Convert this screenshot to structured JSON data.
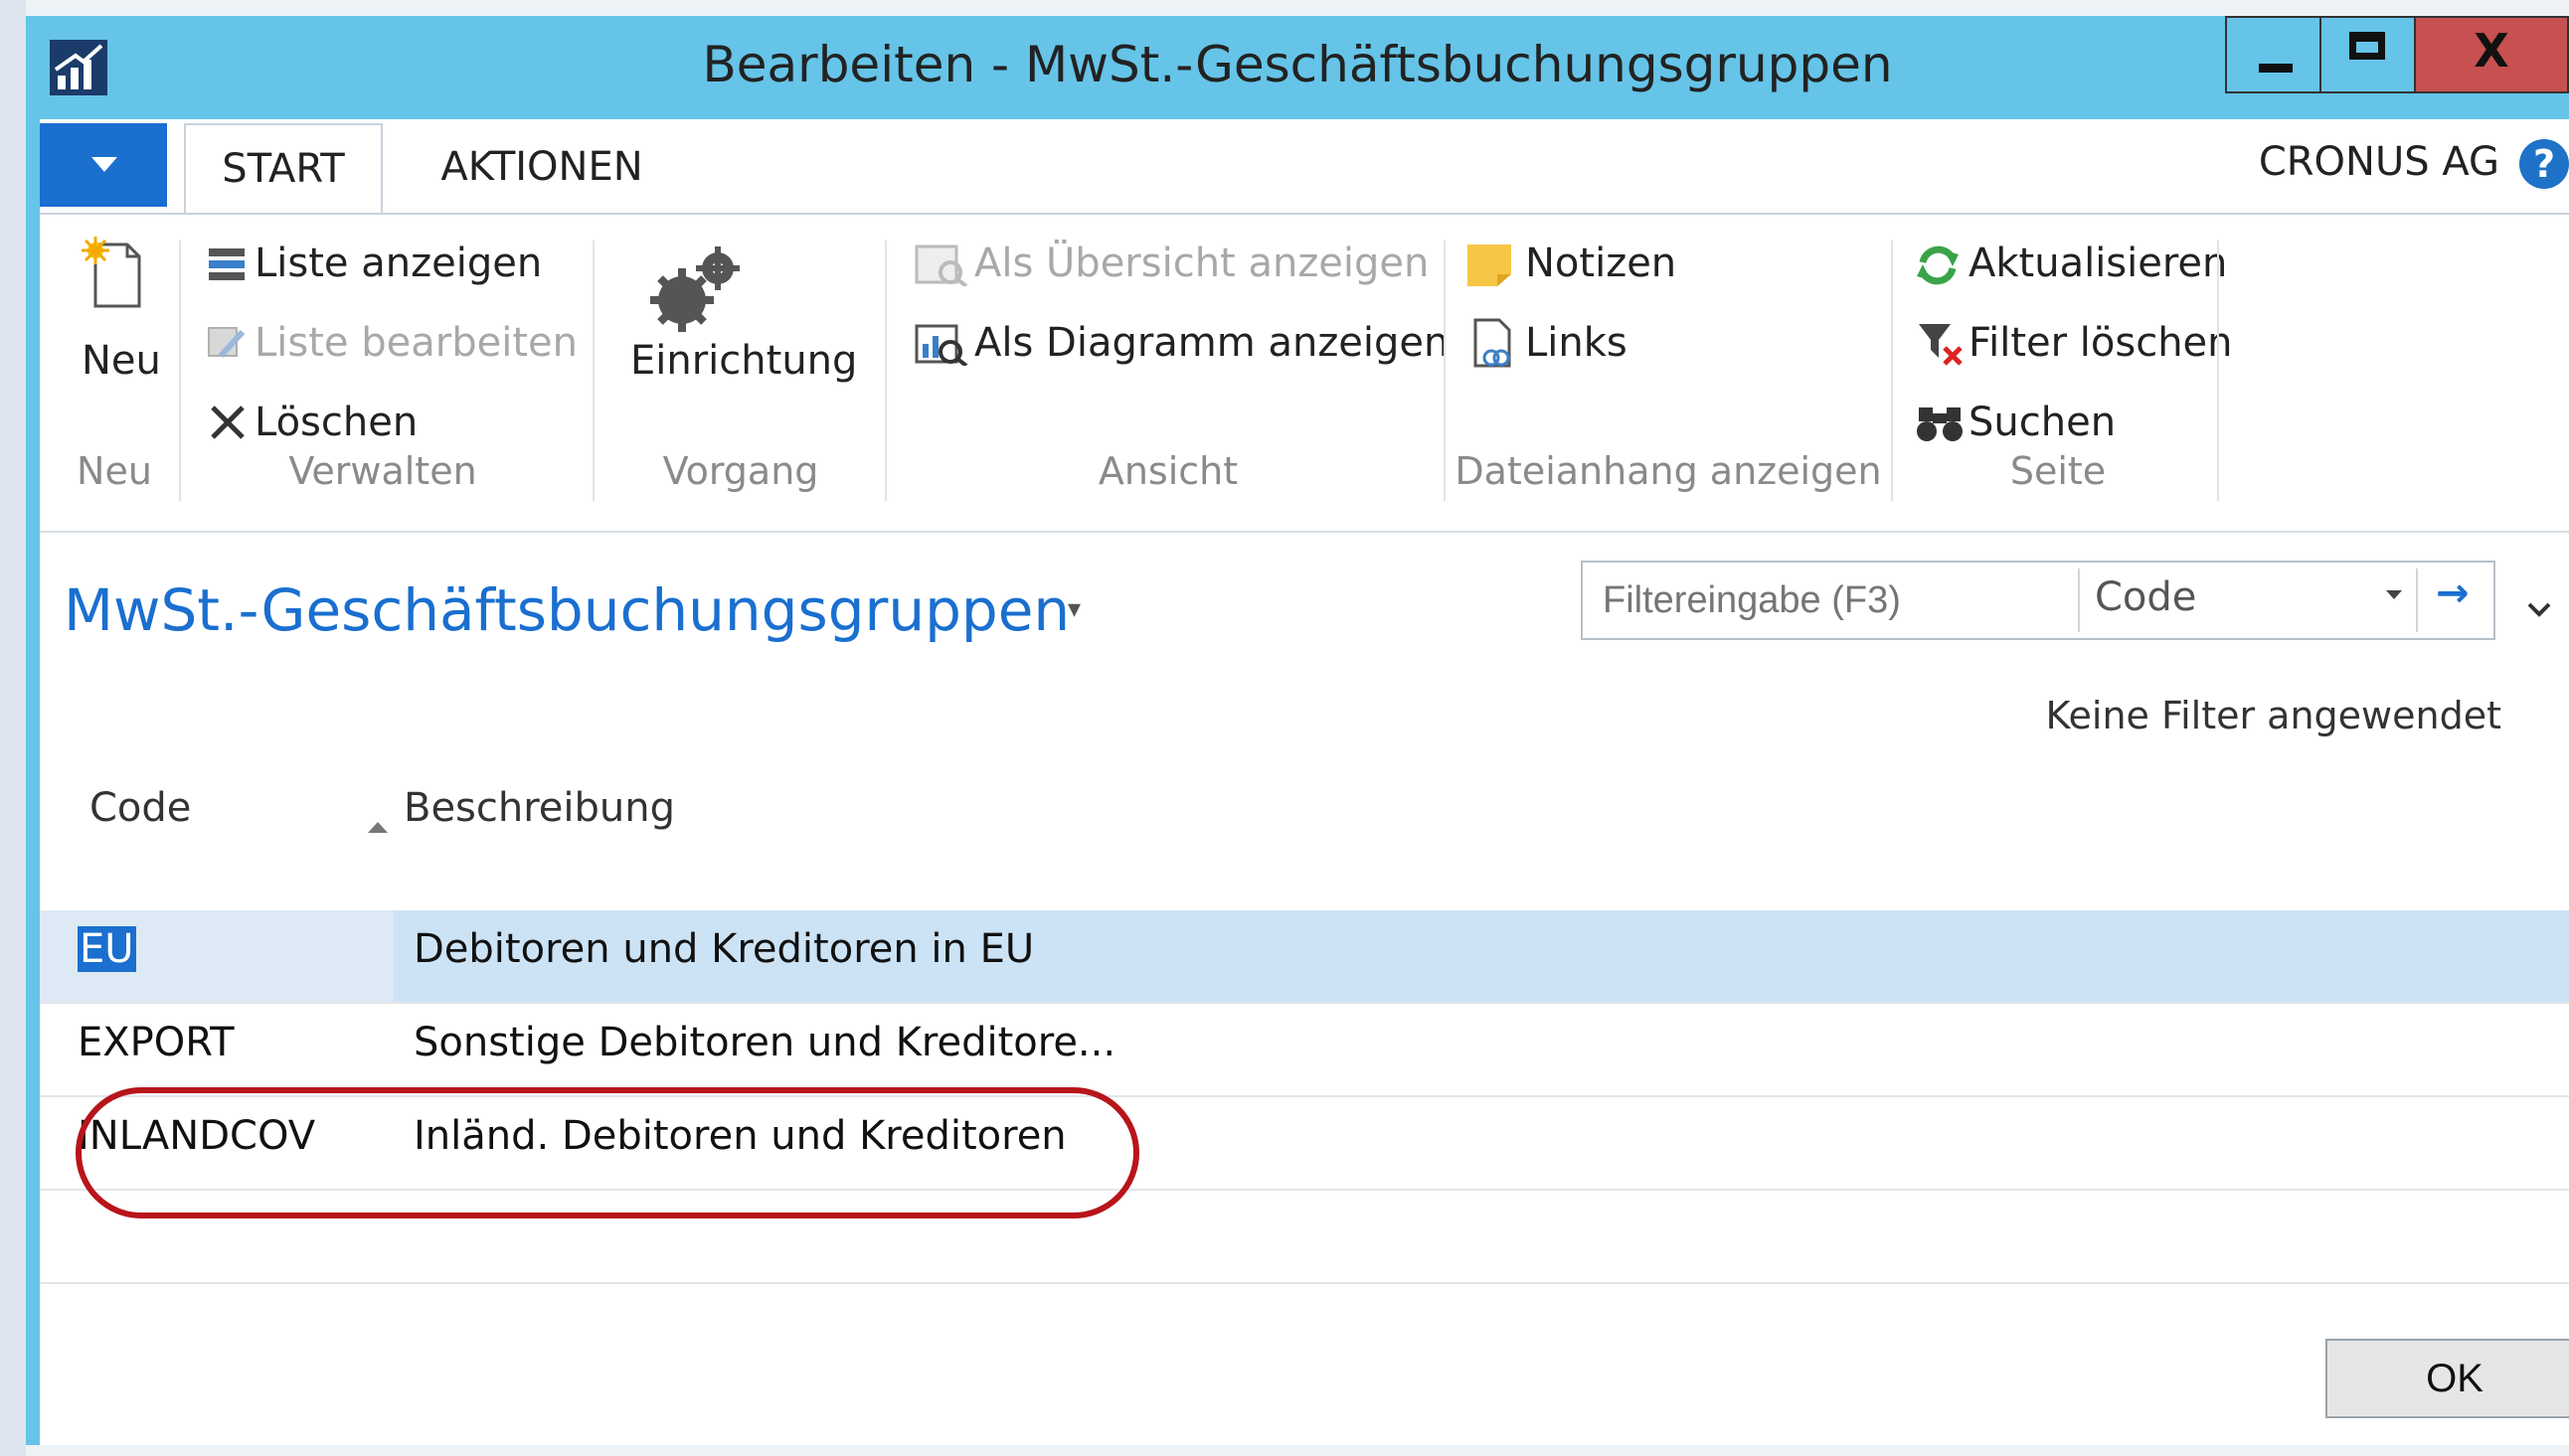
{
  "window": {
    "title": "Bearbeiten - MwSt.-Geschäftsbuchungsgruppen",
    "buttons": {
      "minimize": "_",
      "maximize": "□",
      "close": "X"
    }
  },
  "tabs": [
    {
      "label": "START",
      "active": true
    },
    {
      "label": "AKTIONEN",
      "active": false
    }
  ],
  "company": "CRONUS AG",
  "help_glyph": "?",
  "ribbon": {
    "groups": [
      {
        "label": "Neu",
        "items": [
          {
            "label": "Neu",
            "icon": "new-document-icon",
            "enabled": true
          }
        ]
      },
      {
        "label": "Verwalten",
        "items": [
          {
            "label": "Liste anzeigen",
            "icon": "list-view-icon",
            "enabled": true
          },
          {
            "label": "Liste bearbeiten",
            "icon": "list-edit-icon",
            "enabled": false
          },
          {
            "label": "Löschen",
            "icon": "delete-x-icon",
            "enabled": true
          }
        ]
      },
      {
        "label": "Vorgang",
        "items": [
          {
            "label": "Einrichtung",
            "icon": "gears-icon",
            "enabled": true
          }
        ]
      },
      {
        "label": "Ansicht",
        "items": [
          {
            "label": "Als Übersicht anzeigen",
            "icon": "overview-icon",
            "enabled": false
          },
          {
            "label": "Als Diagramm anzeigen",
            "icon": "chart-view-icon",
            "enabled": true
          }
        ]
      },
      {
        "label": "Dateianhang anzeigen",
        "items": [
          {
            "label": "Notizen",
            "icon": "note-icon",
            "enabled": true
          },
          {
            "label": "Links",
            "icon": "link-icon",
            "enabled": true
          }
        ]
      },
      {
        "label": "Seite",
        "items": [
          {
            "label": "Aktualisieren",
            "icon": "refresh-icon",
            "enabled": true
          },
          {
            "label": "Filter löschen",
            "icon": "clear-filter-icon",
            "enabled": true
          },
          {
            "label": "Suchen",
            "icon": "binoculars-icon",
            "enabled": true
          }
        ]
      }
    ]
  },
  "page": {
    "title": "MwSt.-Geschäftsbuchungsgruppen",
    "filter": {
      "placeholder": "Filtereingabe (F3)",
      "field": "Code",
      "status": "Keine Filter angewendet"
    },
    "table": {
      "columns": [
        "Code",
        "Beschreibung"
      ],
      "rows": [
        {
          "code": "EU",
          "description": "Debitoren und Kreditoren in EU",
          "selected": true
        },
        {
          "code": "EXPORT",
          "description": "Sonstige Debitoren und Kreditore...",
          "selected": false
        },
        {
          "code": "INLANDCOV",
          "description": "Inländ. Debitoren und Kreditoren",
          "selected": false
        }
      ]
    },
    "ok_label": "OK"
  },
  "colors": {
    "titlebar": "#65c4e8",
    "accent": "#1a6fcf",
    "selection": "#cce3f6",
    "close": "#c75050",
    "annotation": "#b8141b"
  }
}
